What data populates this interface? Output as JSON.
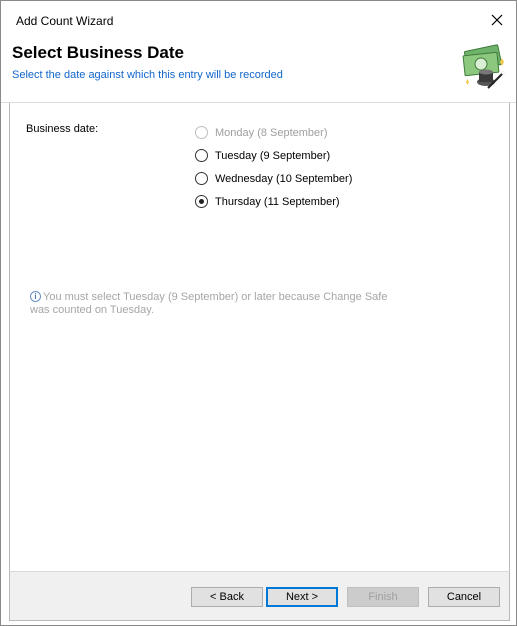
{
  "window": {
    "title": "Add Count Wizard"
  },
  "header": {
    "title": "Select Business Date",
    "subtitle": "Select the date against which this entry will be recorded"
  },
  "form": {
    "field_label": "Business date:",
    "options": [
      {
        "label": "Monday (8 September)",
        "enabled": false,
        "selected": false
      },
      {
        "label": "Tuesday (9 September)",
        "enabled": true,
        "selected": false
      },
      {
        "label": "Wednesday (10 September)",
        "enabled": true,
        "selected": false
      },
      {
        "label": "Thursday (11 September)",
        "enabled": true,
        "selected": true
      }
    ],
    "info_line1": "You must select Tuesday (9 September) or later because Change Safe",
    "info_line2": "was counted on Tuesday."
  },
  "buttons": {
    "back": "< Back",
    "next": "Next >",
    "finish": "Finish",
    "cancel": "Cancel"
  },
  "icons": {
    "close": "close-icon",
    "header": "money-wand-icon",
    "info": "info-icon"
  },
  "colors": {
    "subtitle": "#1166cc",
    "default_button_border": "#0078d7"
  }
}
